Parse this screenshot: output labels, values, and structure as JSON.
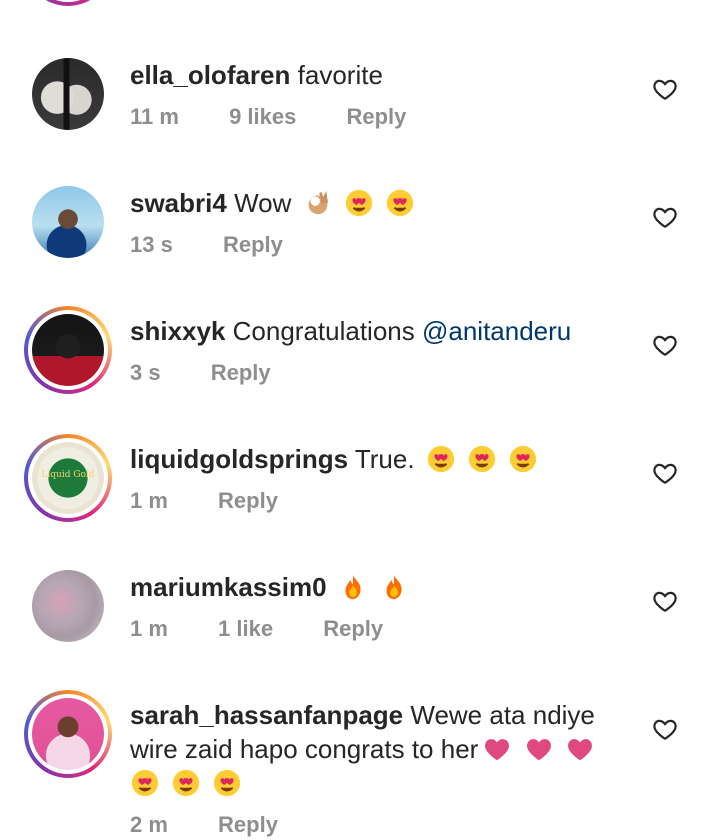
{
  "comments": [
    {
      "username": "ella_olofaren",
      "text": "favorite",
      "time": "11 m",
      "likes": "9 likes",
      "reply": "Reply",
      "has_story_ring": false,
      "emojis": []
    },
    {
      "username": "swabri4",
      "text": "Wow",
      "time": "13 s",
      "likes": "",
      "reply": "Reply",
      "has_story_ring": false,
      "emojis": [
        "ok-hand-emoji",
        "heart-eyes-emoji",
        "heart-eyes-emoji"
      ]
    },
    {
      "username": "shixxyk",
      "text": "Congratulations ",
      "mention": "@anitanderu",
      "time": "3 s",
      "likes": "",
      "reply": "Reply",
      "has_story_ring": true,
      "emojis": []
    },
    {
      "username": "liquidgoldsprings",
      "text": "True.",
      "time": "1 m",
      "likes": "",
      "reply": "Reply",
      "has_story_ring": true,
      "avatar_logo_text": "Liquid Gold",
      "emojis": [
        "heart-eyes-emoji",
        "heart-eyes-emoji",
        "heart-eyes-emoji"
      ]
    },
    {
      "username": "mariumkassim0",
      "text": "",
      "time": "1 m",
      "likes": "1 like",
      "reply": "Reply",
      "has_story_ring": false,
      "emojis": [
        "fire-emoji",
        "fire-emoji"
      ]
    },
    {
      "username": "sarah_hassanfanpage",
      "text": "Wewe ata ndiye wire zaid hapo congrats to  her",
      "time": "2 m",
      "likes": "",
      "reply": "Reply",
      "has_story_ring": true,
      "emojis": [
        "pink-heart-emoji",
        "pink-heart-emoji",
        "pink-heart-emoji",
        "heart-eyes-emoji",
        "heart-eyes-emoji",
        "heart-eyes-emoji"
      ]
    }
  ],
  "colors": {
    "text": "#262626",
    "meta": "#8e8e8e",
    "mention": "#00376b",
    "pink_heart": "#e0497f"
  }
}
